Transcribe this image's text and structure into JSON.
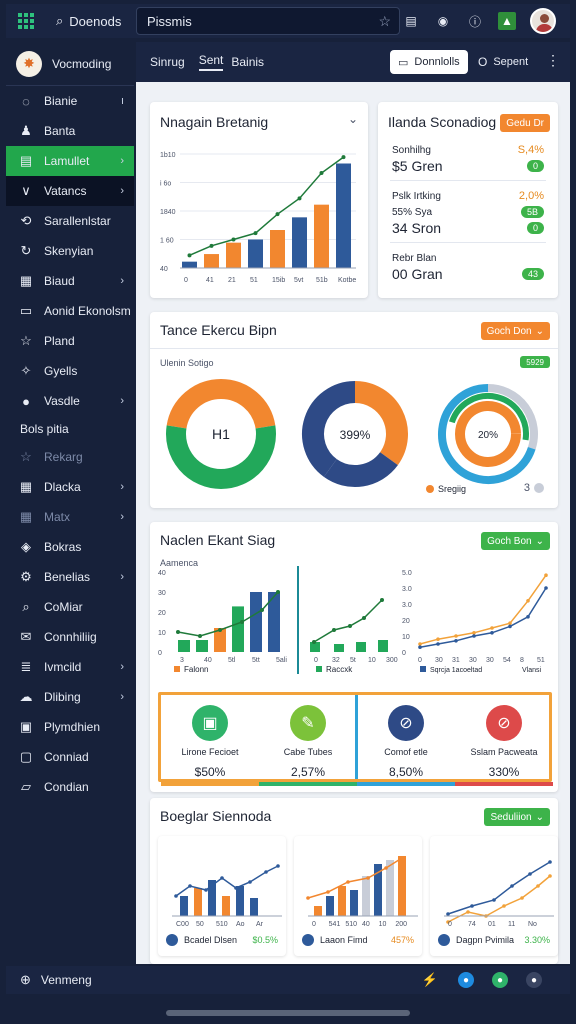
{
  "topbar": {
    "title": "Doenods",
    "search_value": "Pissmis"
  },
  "sidebar": {
    "brand": "Vocmoding",
    "items": [
      {
        "label": "Bianie",
        "icon": "circle-icon",
        "chev": "ı"
      },
      {
        "label": "Banta",
        "icon": "person-icon",
        "chev": ""
      },
      {
        "label": "Lamullet",
        "icon": "file-icon",
        "chev": "›"
      },
      {
        "label": "Vatancs",
        "icon": "v-icon",
        "chev": "›"
      },
      {
        "label": "Sarallenlstar",
        "icon": "link-icon",
        "chev": ""
      },
      {
        "label": "Skenyian",
        "icon": "refresh-icon",
        "chev": ""
      },
      {
        "label": "Biaud",
        "icon": "doc-icon",
        "chev": "›"
      },
      {
        "label": "Aonid Ekonolsm",
        "icon": "screen-icon",
        "chev": ""
      },
      {
        "label": "Pland",
        "icon": "star-icon",
        "chev": ""
      },
      {
        "label": "Gyells",
        "icon": "spark-icon",
        "chev": ""
      },
      {
        "label": "Vasdle",
        "icon": "dot-icon",
        "chev": "›"
      }
    ],
    "section": "Bols pitia",
    "items2": [
      {
        "label": "Rekarg",
        "icon": "star-icon",
        "chev": ""
      },
      {
        "label": "Dlacka",
        "icon": "doc-icon",
        "chev": "›"
      },
      {
        "label": "Matx",
        "icon": "grid-icon",
        "chev": "›"
      },
      {
        "label": "Bokras",
        "icon": "tag-icon",
        "chev": ""
      },
      {
        "label": "Benelias",
        "icon": "gear-icon",
        "chev": "›"
      },
      {
        "label": "CoMiar",
        "icon": "search-icon",
        "chev": ""
      },
      {
        "label": "Connhiliig",
        "icon": "mail-icon",
        "chev": ""
      },
      {
        "label": "Ivmcild",
        "icon": "list-icon",
        "chev": "›"
      },
      {
        "label": "Dlibing",
        "icon": "cloud-icon",
        "chev": "›"
      },
      {
        "label": "Plymdhien",
        "icon": "monitor-icon",
        "chev": ""
      },
      {
        "label": "Conniad",
        "icon": "box-icon",
        "chev": ""
      },
      {
        "label": "Condian",
        "icon": "chat-icon",
        "chev": ""
      }
    ],
    "footer": "Venmeng"
  },
  "tabs": [
    "Sinrug",
    "Sent",
    "Bainis"
  ],
  "tab_buttons": {
    "primary": "Donnlolls",
    "secondary": "Sepent"
  },
  "card1": {
    "title": "Nnagain Bretanig",
    "ylabels": [
      "1b10",
      "i 6o",
      "1840",
      "1 60",
      "40"
    ],
    "xlabels": [
      "0",
      "41",
      "21",
      "51",
      "15ib",
      "5vt",
      "51b",
      "Kotbe"
    ]
  },
  "card2": {
    "title": "Ilanda Sconadiog",
    "button": "Gedu Dr",
    "rows": [
      {
        "label": "Sonhilhg",
        "value": "S,4%",
        "color": "#e68a1f"
      },
      {
        "label": "$5 Gren",
        "value": "0",
        "color": "#3db34a",
        "big": true
      },
      {
        "label": "Pslk Irtking",
        "value": "2,0%",
        "color": "#e68a1f"
      },
      {
        "label": "55% Sya",
        "value": "5B",
        "color": "#3db34a"
      },
      {
        "label": "34 Sron",
        "value": "0",
        "color": "#3db34a",
        "big": true
      },
      {
        "label": "Rebr Blan",
        "value": "",
        "color": ""
      },
      {
        "label": "00 Gran",
        "value": "43",
        "color": "#3db34a",
        "big": true
      }
    ]
  },
  "card3": {
    "title": "Tance Ekercu Bipn",
    "button": "Goch Don",
    "subtitle": "Ulenin Sotigo",
    "badge": "5929",
    "donut1_label": "H1",
    "donut2_label": "399%",
    "donut3_label": "20%",
    "legend": "Sregiig",
    "legend_count": "3"
  },
  "card4": {
    "title": "Naclen Ekant Siag",
    "button": "Goch Bon",
    "subtitle": "Aamenca",
    "chart1_x": [
      "3",
      "40",
      "5tl",
      "5tt",
      "5ali"
    ],
    "chart1_y": [
      "40",
      "30",
      "20",
      "10",
      "0"
    ],
    "chart1_legend": "Falonn",
    "chart2_x": [
      "0",
      "32",
      "5t",
      "10",
      "300"
    ],
    "chart2_legend": "Raccxk",
    "chart3_x": [
      "0",
      "30",
      "31",
      "30",
      "30",
      "54",
      "8",
      "51"
    ],
    "chart3_y": [
      "5.0",
      "3.0",
      "3.0",
      "20",
      "10",
      "0"
    ],
    "chart3_legend": "Sqrcja 1acoeltad",
    "chart3_legend2": "Vlansi",
    "stats": [
      {
        "label": "Lirone Fecioet",
        "value": "$50%",
        "color": "#2fb36a",
        "icon": "phone-icon"
      },
      {
        "label": "Cabe Tubes",
        "value": "2,57%",
        "color": "#7cc23a",
        "icon": "edit-icon"
      },
      {
        "label": "Comof etle",
        "value": "8,50%",
        "color": "#2e4a86",
        "icon": "ban-icon"
      },
      {
        "label": "Sslam Pacweata",
        "value": "330%",
        "color": "#dd4a4a",
        "icon": "ban-icon"
      }
    ]
  },
  "card5": {
    "title": "Boeglar Siennoda",
    "button": "Seduliion",
    "mini": [
      {
        "label": "Bcadel Dlsen",
        "value": "$0.5%",
        "x": [
          "C00",
          "50",
          "510",
          "Ao",
          "Ar"
        ],
        "color": "#3db34a"
      },
      {
        "label": "Laaon Fimd",
        "value": "457%",
        "x": [
          "0",
          "541",
          "510",
          "40",
          "10",
          "200"
        ],
        "color": "#e68a1f"
      },
      {
        "label": "Dagpn Pvimila",
        "value": "3.30%",
        "x": [
          "0",
          "74",
          "01",
          "11",
          "No"
        ],
        "color": "#3db34a"
      }
    ]
  },
  "chart_data": [
    {
      "type": "bar",
      "title": "Nnagain Bretanig",
      "categories": [
        "0",
        "41",
        "21",
        "51",
        "15ib",
        "5vt",
        "51b",
        "Kotbe"
      ],
      "series": [
        {
          "name": "bar",
          "values": [
            10,
            22,
            40,
            45,
            60,
            80,
            100,
            165
          ]
        },
        {
          "name": "line",
          "values": [
            20,
            35,
            45,
            55,
            85,
            110,
            150,
            175
          ]
        }
      ],
      "ylim": [
        0,
        180
      ]
    },
    {
      "type": "pie",
      "title": "Tance Ekercu Bipn",
      "series": [
        {
          "name": "donut1",
          "values": [
            55,
            45
          ]
        },
        {
          "name": "donut2",
          "values": [
            35,
            25,
            40
          ]
        },
        {
          "name": "donut3",
          "values": [
            30,
            70
          ]
        }
      ]
    },
    {
      "type": "bar",
      "title": "Naclen Ekant Siag",
      "categories": [
        "3",
        "40",
        "5tl",
        "5tt",
        "5ali"
      ],
      "series": [
        {
          "name": "bars",
          "values": [
            10,
            10,
            8,
            20,
            30,
            38
          ]
        }
      ]
    },
    {
      "type": "line",
      "title": "Boeglar Siennoda",
      "categories": [
        "0",
        "30",
        "31",
        "30",
        "30",
        "54",
        "8",
        "51"
      ],
      "series": [
        {
          "name": "a",
          "values": [
            5,
            8,
            10,
            12,
            15,
            18,
            32,
            48
          ]
        },
        {
          "name": "b",
          "values": [
            3,
            5,
            7,
            10,
            12,
            16,
            22,
            40
          ]
        }
      ]
    }
  ]
}
